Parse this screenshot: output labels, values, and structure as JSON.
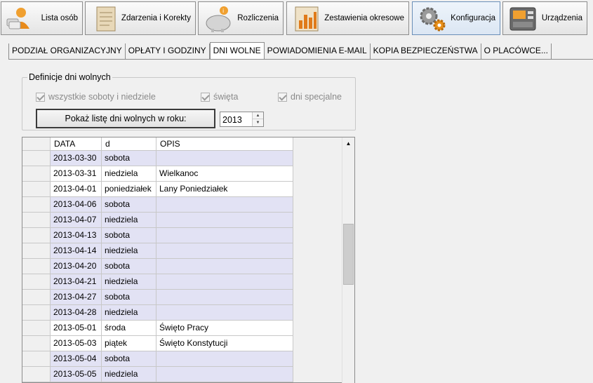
{
  "toolbar": {
    "buttons": [
      {
        "label": "Lista osób",
        "icon": "user-money-icon"
      },
      {
        "label": "Zdarzenia i Korekty",
        "icon": "document-icon"
      },
      {
        "label": "Rozliczenia",
        "icon": "piggy-bank-icon"
      },
      {
        "label": "Zestawienia okresowe",
        "icon": "bar-chart-icon"
      },
      {
        "label": "Konfiguracja",
        "icon": "gears-icon",
        "active": true
      },
      {
        "label": "Urządzenia",
        "icon": "device-icon"
      }
    ]
  },
  "tabs": [
    {
      "label": "PODZIAŁ ORGANIZACYJNY"
    },
    {
      "label": "OPŁATY I GODZINY"
    },
    {
      "label": "DNI WOLNE",
      "active": true
    },
    {
      "label": "POWIADOMIENIA E-MAIL"
    },
    {
      "label": "KOPIA BEZPIECZEŃSTWA"
    },
    {
      "label": "O PLACÓWCE..."
    }
  ],
  "definitions": {
    "title": "Definicje dni wolnych",
    "checkboxes": [
      {
        "label": "wszystkie soboty i niedziele",
        "checked": true
      },
      {
        "label": "święta",
        "checked": true
      },
      {
        "label": "dni specjalne",
        "checked": true
      }
    ],
    "show_button": "Pokaż listę dni wolnych w roku:",
    "year": "2013"
  },
  "grid": {
    "columns": [
      "DATA",
      "d",
      "OPIS"
    ],
    "rows": [
      {
        "date": "2013-03-30",
        "day": "sobota",
        "desc": ""
      },
      {
        "date": "2013-03-31",
        "day": "niedziela",
        "desc": "Wielkanoc"
      },
      {
        "date": "2013-04-01",
        "day": "poniedziałek",
        "desc": "Lany Poniedziałek"
      },
      {
        "date": "2013-04-06",
        "day": "sobota",
        "desc": ""
      },
      {
        "date": "2013-04-07",
        "day": "niedziela",
        "desc": ""
      },
      {
        "date": "2013-04-13",
        "day": "sobota",
        "desc": ""
      },
      {
        "date": "2013-04-14",
        "day": "niedziela",
        "desc": ""
      },
      {
        "date": "2013-04-20",
        "day": "sobota",
        "desc": ""
      },
      {
        "date": "2013-04-21",
        "day": "niedziela",
        "desc": ""
      },
      {
        "date": "2013-04-27",
        "day": "sobota",
        "desc": ""
      },
      {
        "date": "2013-04-28",
        "day": "niedziela",
        "desc": ""
      },
      {
        "date": "2013-05-01",
        "day": "środa",
        "desc": "Święto Pracy"
      },
      {
        "date": "2013-05-03",
        "day": "piątek",
        "desc": "Święto Konstytucji"
      },
      {
        "date": "2013-05-04",
        "day": "sobota",
        "desc": ""
      },
      {
        "date": "2013-05-05",
        "day": "niedziela",
        "desc": ""
      }
    ]
  },
  "colors": {
    "weekend_row": "#e2e2f4",
    "holiday_row": "#ffffff",
    "accent": "#f5a623"
  }
}
